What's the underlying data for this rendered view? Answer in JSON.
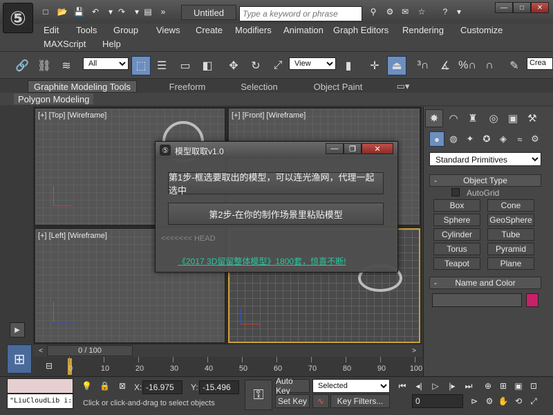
{
  "titlebar": {
    "doc_title": "Untitled",
    "search_placeholder": "Type a keyword or phrase",
    "logo": "3ds-max-logo",
    "minimize": "—",
    "maximize": "□",
    "close": "✕"
  },
  "menu": {
    "items": [
      "Edit",
      "Tools",
      "Group",
      "Views",
      "Create",
      "Modifiers",
      "Animation",
      "Graph Editors",
      "Rendering",
      "Customize",
      "MAXScript",
      "Help"
    ]
  },
  "toolbar": {
    "filter_value": "All",
    "coord_value": "View",
    "named_selection": "Crea"
  },
  "ribbon": {
    "tabs": [
      "Graphite Modeling Tools",
      "Freeform",
      "Selection",
      "Object Paint"
    ],
    "sub_panel": "Polygon Modeling"
  },
  "viewports": {
    "top": "[+] [Top] [Wireframe]",
    "front": "[+] [Front] [Wireframe]",
    "left": "[+] [Left] [Wireframe]"
  },
  "dialog": {
    "title": "模型取取v1.0",
    "step1": "第1步-框选要取出的模型，可以连光渔网，代理一起选中",
    "step2": "第2步-在你的制作场景里粘贴模型",
    "head_text": "<<<<<<< HEAD",
    "promo": "《2017 3D留留整体模型》1800套，惊喜不断!",
    "minimize": "—",
    "restore": "❐",
    "close": "✕"
  },
  "command_panel": {
    "category": "Standard Primitives",
    "object_type_title": "Object Type",
    "autogrid_label": "AutoGrid",
    "primitives": [
      "Box",
      "Cone",
      "Sphere",
      "GeoSphere",
      "Cylinder",
      "Tube",
      "Torus",
      "Pyramid",
      "Teapot",
      "Plane"
    ],
    "name_color_title": "Name and Color",
    "object_color": "#c8206a"
  },
  "timeline": {
    "frame_counter": "0 / 100",
    "ticks": [
      "0",
      "10",
      "20",
      "30",
      "40",
      "50",
      "60",
      "70",
      "80",
      "90",
      "100"
    ]
  },
  "status": {
    "maxscript_listener": "\"LiuCloudLib i:",
    "prompt": "Click or click-and-drag to select objects",
    "x_label": "X:",
    "x_value": "-16.975",
    "y_label": "Y:",
    "y_value": "-15.496",
    "auto_key": "Auto Key",
    "set_key": "Set Key",
    "selected": "Selected",
    "key_filters": "Key Filters...",
    "frame_value": "0"
  },
  "colors": {
    "accent_blue": "#6d8fbf",
    "link_green": "#29c7a0",
    "selected_viewport": "#c8a03c"
  }
}
